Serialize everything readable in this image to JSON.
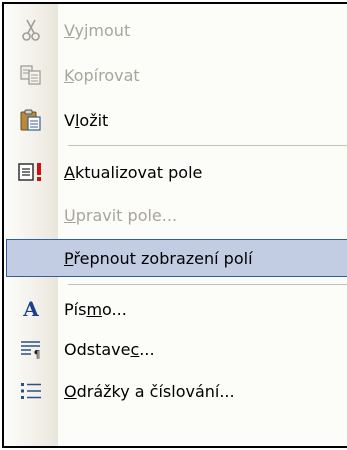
{
  "menu": {
    "items": [
      {
        "pre": "",
        "ul": "V",
        "post": "yjmout",
        "icon": "scissors-icon",
        "enabled": false
      },
      {
        "pre": "",
        "ul": "K",
        "post": "opírovat",
        "icon": "copy-icon",
        "enabled": false
      },
      {
        "pre": "V",
        "ul": "l",
        "post": "ožit",
        "icon": "paste-icon",
        "enabled": true
      },
      {
        "pre": "",
        "ul": "A",
        "post": "ktualizovat pole",
        "icon": "update-field-icon",
        "enabled": true
      },
      {
        "pre": "",
        "ul": "U",
        "post": "pravit pole...",
        "icon": "",
        "enabled": false
      },
      {
        "pre": "",
        "ul": "P",
        "post": "řepnout zobrazení polí",
        "icon": "",
        "enabled": true,
        "highlighted": true
      },
      {
        "pre": "Pís",
        "ul": "m",
        "post": "o...",
        "icon": "font-icon",
        "enabled": true
      },
      {
        "pre": "Odstave",
        "ul": "c",
        "post": "...",
        "icon": "paragraph-icon",
        "enabled": true
      },
      {
        "pre": "",
        "ul": "O",
        "post": "drážky a číslování...",
        "icon": "bullets-numbering-icon",
        "enabled": true
      }
    ]
  }
}
